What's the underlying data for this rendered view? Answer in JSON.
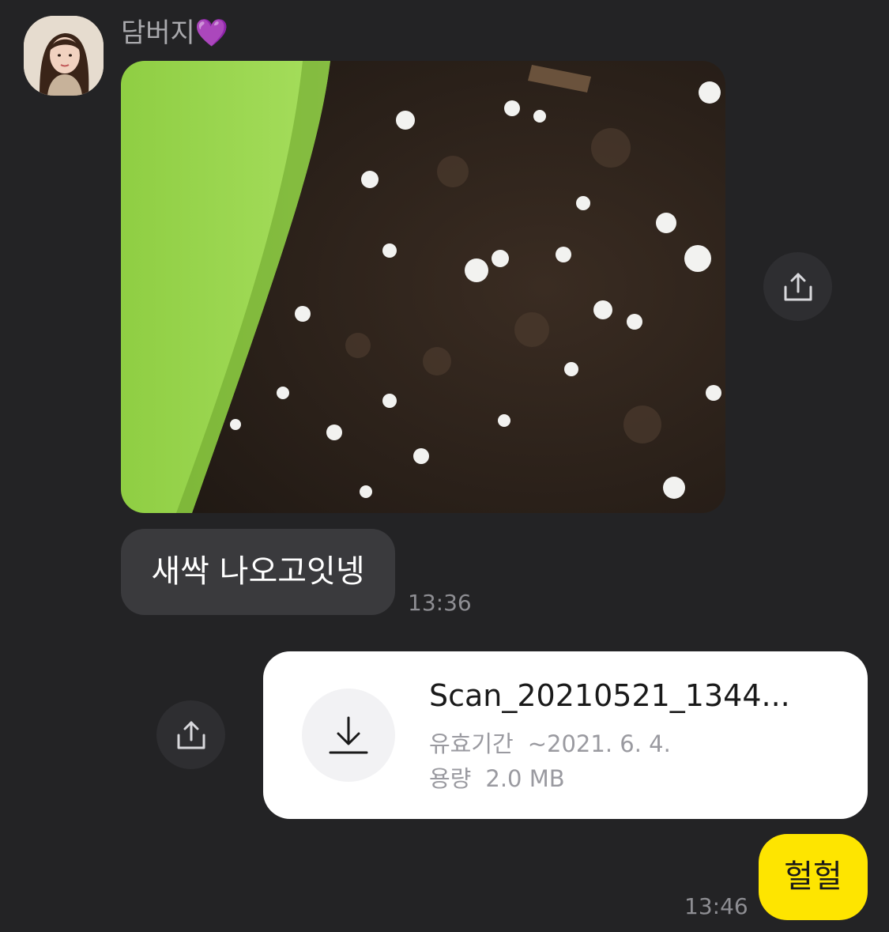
{
  "sender": {
    "name": "담버지💜"
  },
  "messages": {
    "photo": {
      "image": "soil-in-green-pot-photo"
    },
    "incoming_text": "새싹 나오고잇넹",
    "incoming_time": "13:36",
    "file": {
      "name": "Scan_20210521_1344...",
      "expiry_label": "유효기간",
      "expiry_value": "~2021. 6. 4.",
      "size_label": "용량",
      "size_value": "2.0 MB"
    },
    "outgoing_text": "헐헐",
    "outgoing_time": "13:46"
  },
  "icons": {
    "share": "share-icon",
    "download": "download-icon"
  },
  "colors": {
    "background": "#232325",
    "incoming_bubble": "#3a3a3d",
    "outgoing_bubble": "#fee500",
    "file_card": "#ffffff"
  }
}
